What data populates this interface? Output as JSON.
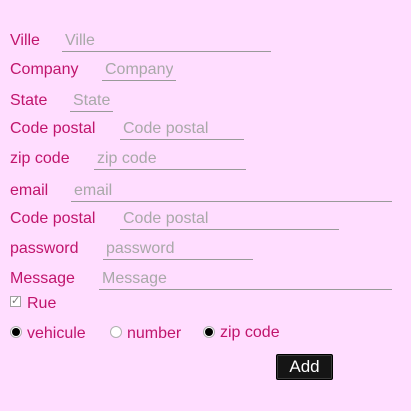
{
  "form": {
    "fields": [
      {
        "label": "Ville",
        "placeholder": "Ville"
      },
      {
        "label": "Company",
        "placeholder": "Company"
      },
      {
        "label": "State",
        "placeholder": "State"
      },
      {
        "label": "Code postal",
        "placeholder": "Code postal"
      },
      {
        "label": "zip code",
        "placeholder": "zip code"
      },
      {
        "label": "email",
        "placeholder": "email"
      },
      {
        "label": "Code postal",
        "placeholder": "Code postal"
      },
      {
        "label": "password",
        "placeholder": "password"
      },
      {
        "label": "Message",
        "placeholder": "Message"
      }
    ],
    "checkbox": {
      "label": "Rue",
      "checked": true
    },
    "radios": [
      {
        "label": "vehicule",
        "checked": true
      },
      {
        "label": "number",
        "checked": false
      },
      {
        "label": "zip code",
        "checked": true
      }
    ],
    "submit_label": "Add"
  },
  "colors": {
    "background": "#ffddff",
    "label": "#c0146c",
    "button": "#151515"
  }
}
